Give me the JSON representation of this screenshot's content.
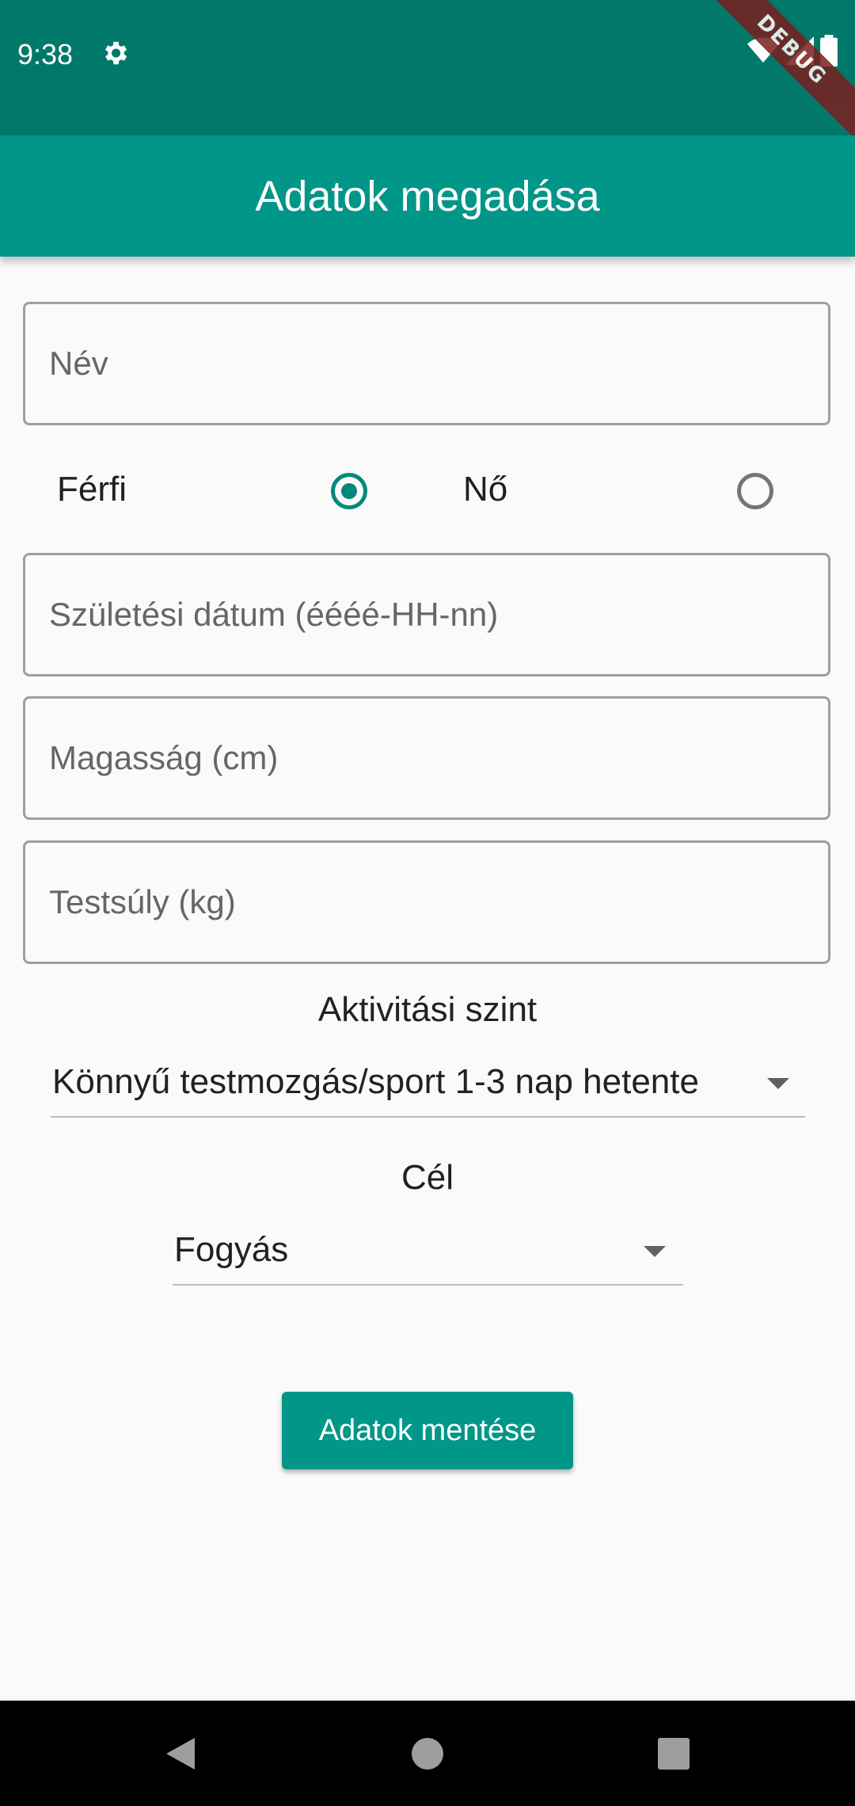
{
  "status_bar": {
    "time": "9:38",
    "debug_badge": "DEBUG"
  },
  "app_bar": {
    "title": "Adatok megadása"
  },
  "form": {
    "name_placeholder": "Név",
    "gender": {
      "male_label": "Férfi",
      "female_label": "Nő",
      "selected": "male"
    },
    "birthdate_placeholder": "Születési dátum (éééé-HH-nn)",
    "height_placeholder": "Magasság (cm)",
    "weight_placeholder": "Testsúly (kg)",
    "activity": {
      "label": "Aktivitási szint",
      "selected": "Könnyű testmozgás/sport 1-3 nap hetente"
    },
    "goal": {
      "label": "Cél",
      "selected": "Fogyás"
    },
    "save_label": "Adatok mentése"
  },
  "colors": {
    "primary": "#009688",
    "primary_dark": "#00796b",
    "accent": "#00897b"
  },
  "icons": [
    "gear-icon",
    "wifi-icon",
    "signal-icon",
    "battery-icon",
    "back-icon",
    "home-icon",
    "recents-icon",
    "chevron-down-icon"
  ]
}
